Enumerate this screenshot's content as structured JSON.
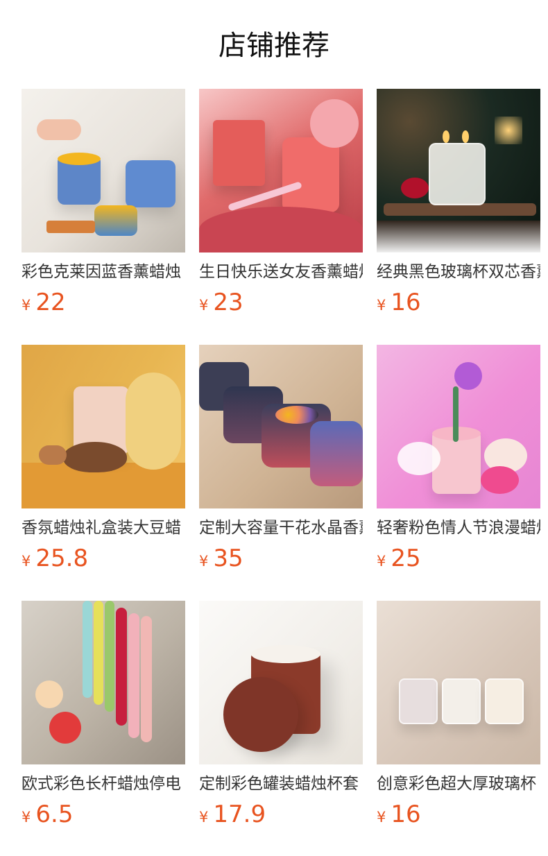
{
  "page": {
    "title": "店铺推荐"
  },
  "products": [
    {
      "name": "彩色克莱因蓝香薰蜡烛",
      "currency": "¥",
      "price": "22"
    },
    {
      "name": "生日快乐送女友香薰蜡烛",
      "currency": "¥",
      "price": "23"
    },
    {
      "name": "经典黑色玻璃杯双芯香薰",
      "currency": "¥",
      "price": "16"
    },
    {
      "name": "香氛蜡烛礼盒装大豆蜡",
      "currency": "¥",
      "price": "25.8"
    },
    {
      "name": "定制大容量干花水晶香薰",
      "currency": "¥",
      "price": "35"
    },
    {
      "name": "轻奢粉色情人节浪漫蜡烛",
      "currency": "¥",
      "price": "25"
    },
    {
      "name": "欧式彩色长杆蜡烛停电",
      "currency": "¥",
      "price": "6.5"
    },
    {
      "name": "定制彩色罐装蜡烛杯套",
      "currency": "¥",
      "price": "17.9"
    },
    {
      "name": "创意彩色超大厚玻璃杯",
      "currency": "¥",
      "price": "16"
    }
  ]
}
